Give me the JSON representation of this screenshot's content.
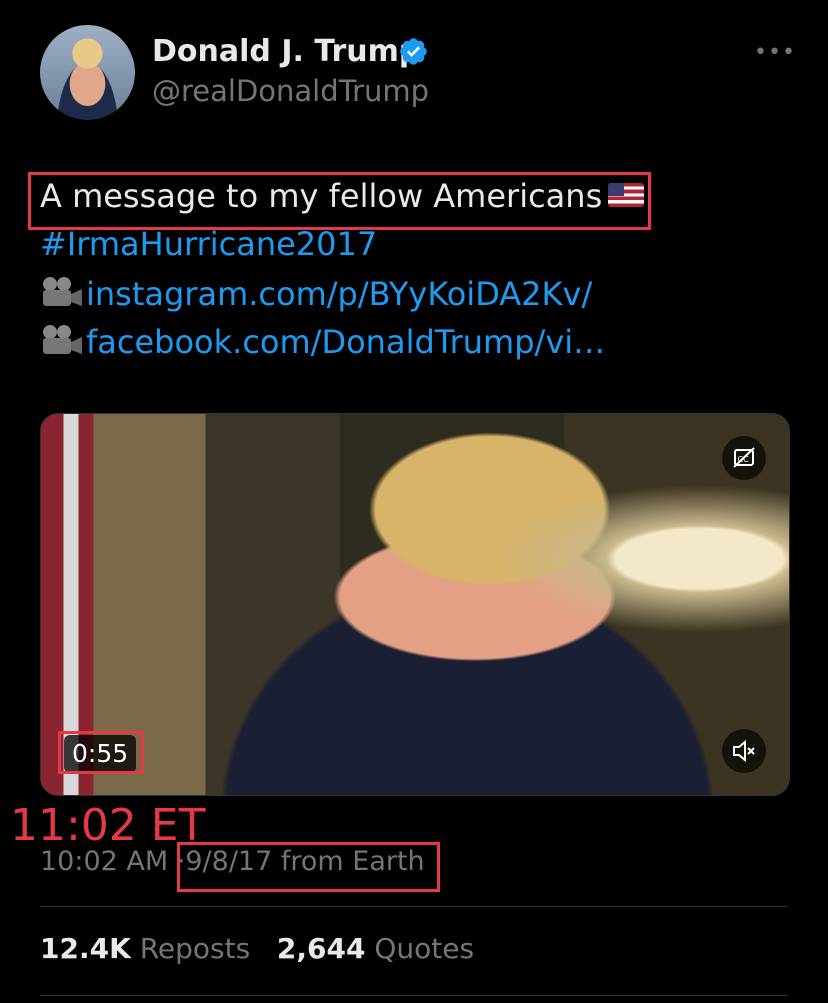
{
  "author": {
    "name": "Donald J. Trump",
    "handle": "@realDonaldTrump",
    "avatar_icon": "profile-photo",
    "verified_icon": "verified-badge-icon",
    "more_label": "•••"
  },
  "tweet": {
    "text": "A message to my fellow Americans",
    "emoji": "us-flag-emoji",
    "hashtag": "#IrmaHurricane2017",
    "link1": "instagram.com/p/BYyKoiDA2Kv/",
    "link2": "facebook.com/DonaldTrump/vi…",
    "link_icon": "movie-camera-emoji"
  },
  "video": {
    "duration": "0:55",
    "cc_icon": "captions-off-icon",
    "mute_icon": "volume-muted-icon"
  },
  "annotation": {
    "text": "11:02 ET",
    "color": "#e63946"
  },
  "meta": {
    "time": "10:02 AM",
    "separator": "·",
    "date_source": "9/8/17 from Earth"
  },
  "stats": {
    "reposts_count": "12.4K",
    "reposts_label": "Reposts",
    "quotes_count": "2,644",
    "quotes_label": "Quotes"
  },
  "colors": {
    "background": "#000000",
    "link": "#1d9bf0",
    "secondary": "#71767b",
    "highlight_box": "#e63946"
  }
}
